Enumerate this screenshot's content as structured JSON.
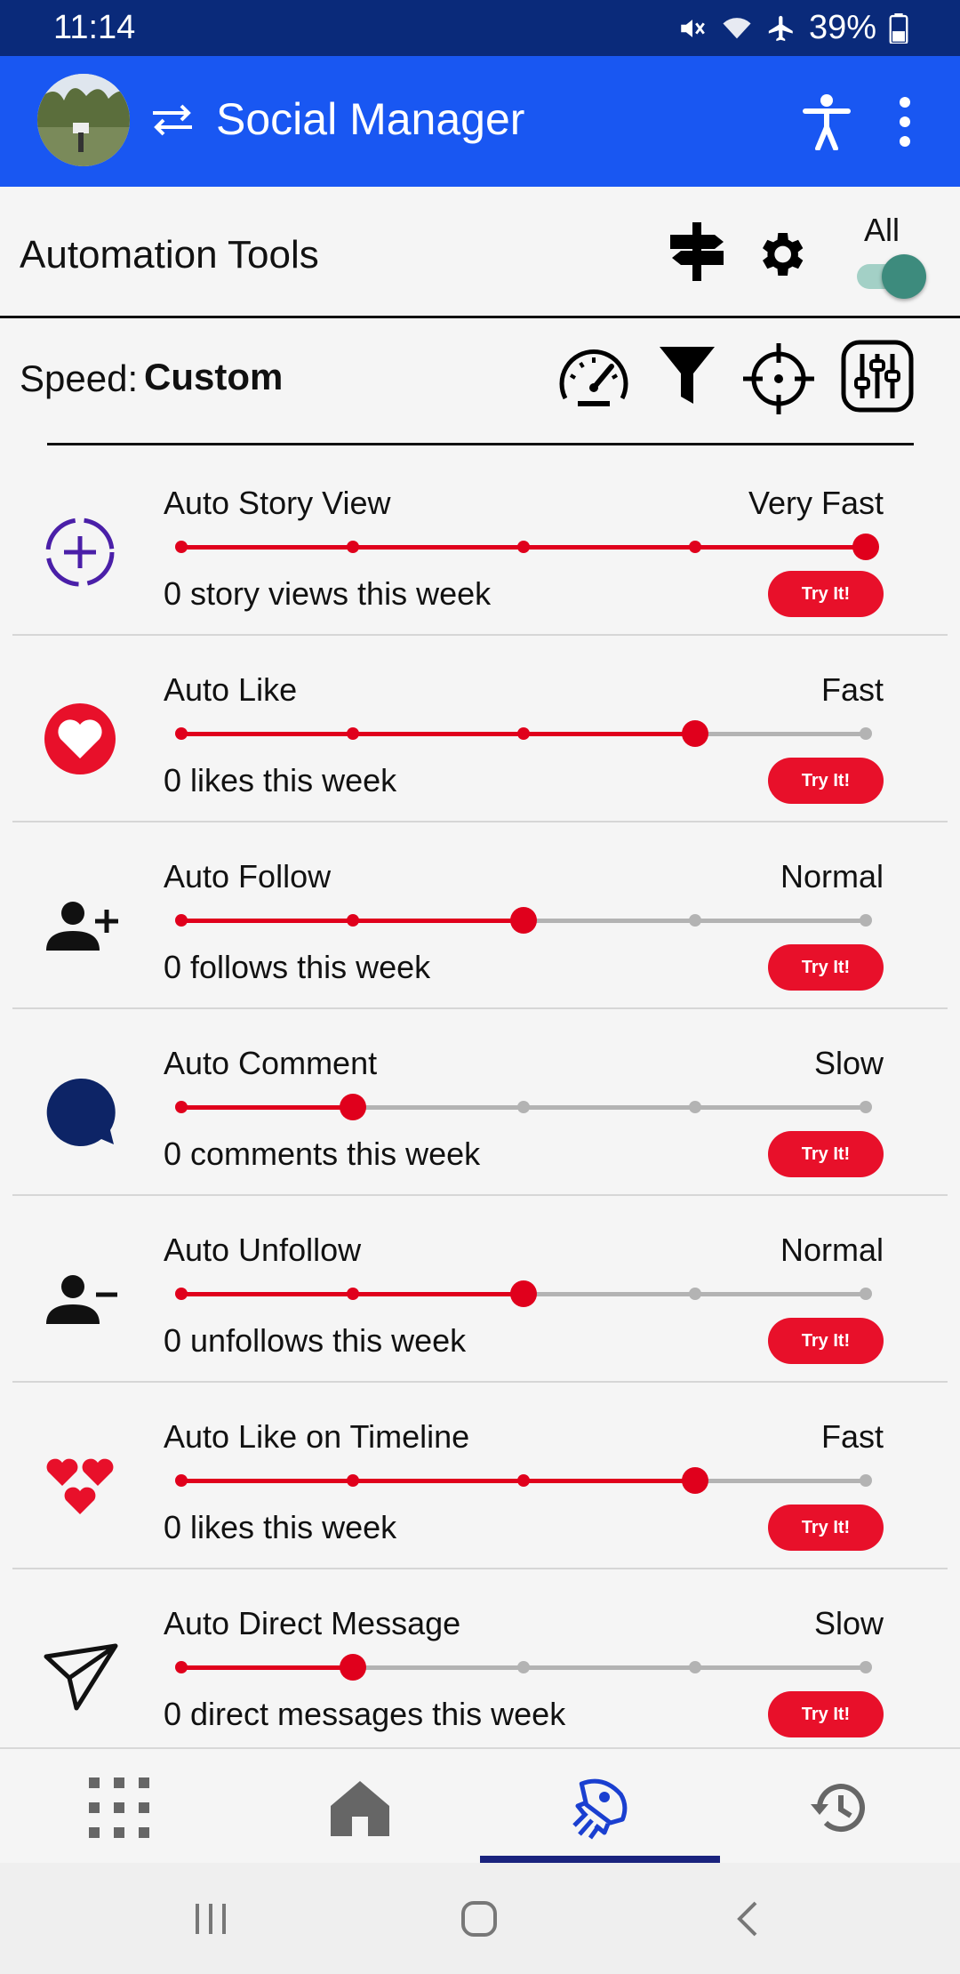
{
  "status_bar": {
    "time": "11:14",
    "battery": "39%"
  },
  "app_bar": {
    "title": "Social Manager"
  },
  "tools": {
    "title": "Automation Tools",
    "all_label": "All",
    "all_enabled": true
  },
  "speed": {
    "label": "Speed:",
    "value": "Custom"
  },
  "colors": {
    "accent": "#1957f2",
    "status_bar": "#0a2a7a",
    "slider_active": "#e0001c",
    "try_button": "#e8102a",
    "toggle": "#3d8b7d",
    "nav_active": "#1a3fd0"
  },
  "automations": [
    {
      "label": "Auto Story View",
      "speed": "Very Fast",
      "level": 5,
      "stat": "0 story views this week",
      "button": "Try It!",
      "icon": "story-add-icon"
    },
    {
      "label": "Auto Like",
      "speed": "Fast",
      "level": 4,
      "stat": "0 likes this week",
      "button": "Try It!",
      "icon": "heart-icon"
    },
    {
      "label": "Auto Follow",
      "speed": "Normal",
      "level": 3,
      "stat": "0 follows this week",
      "button": "Try It!",
      "icon": "person-add-icon"
    },
    {
      "label": "Auto Comment",
      "speed": "Slow",
      "level": 2,
      "stat": "0 comments this week",
      "button": "Try It!",
      "icon": "comment-bubble-icon"
    },
    {
      "label": "Auto Unfollow",
      "speed": "Normal",
      "level": 3,
      "stat": "0 unfollows this week",
      "button": "Try It!",
      "icon": "person-remove-icon"
    },
    {
      "label": "Auto Like on Timeline",
      "speed": "Fast",
      "level": 4,
      "stat": "0 likes this week",
      "button": "Try It!",
      "icon": "hearts-icon"
    },
    {
      "label": "Auto Direct Message",
      "speed": "Slow",
      "level": 2,
      "stat": "0 direct messages this week",
      "button": "Try It!",
      "icon": "send-icon"
    }
  ],
  "bottom_nav": [
    "grid-icon",
    "home-icon",
    "rocket-icon",
    "history-icon"
  ],
  "bottom_nav_active": 2
}
